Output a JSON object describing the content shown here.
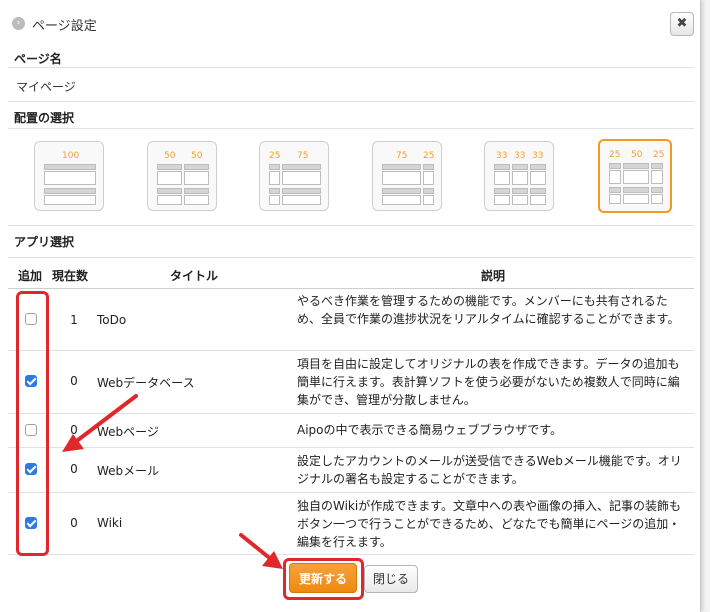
{
  "dialog": {
    "title": "ページ設定",
    "close_label": "✖"
  },
  "page_name": {
    "label": "ページ名",
    "value": "マイページ"
  },
  "layout": {
    "label": "配置の選択",
    "options": [
      {
        "id": "100",
        "nums": [
          "100"
        ]
      },
      {
        "id": "50-50",
        "nums": [
          "50",
          "50"
        ]
      },
      {
        "id": "25-75",
        "nums": [
          "25",
          "75"
        ]
      },
      {
        "id": "75-25",
        "nums": [
          "75",
          "25"
        ]
      },
      {
        "id": "33-33-33",
        "nums": [
          "33",
          "33",
          "33"
        ]
      },
      {
        "id": "25-50-25",
        "nums": [
          "25",
          "50",
          "25"
        ]
      }
    ],
    "selected": "25-50-25"
  },
  "apps": {
    "label": "アプリ選択",
    "headers": {
      "add": "追加",
      "count": "現在数",
      "title": "タイトル",
      "desc": "説明"
    },
    "rows": [
      {
        "checked": false,
        "count": "1",
        "title": "ToDo",
        "desc": "やるべき作業を管理するための機能です。メンバーにも共有されるため、全員で作業の進捗状況をリアルタイムに確認することができます。"
      },
      {
        "checked": true,
        "count": "0",
        "title": "Webデータベース",
        "desc": "項目を自由に設定してオリジナルの表を作成できます。データの追加も簡単に行えます。表計算ソフトを使う必要がないため複数人で同時に編集ができ、管理が分散しません。"
      },
      {
        "checked": false,
        "count": "0",
        "title": "Webページ",
        "desc": "Aipoの中で表示できる簡易ウェブブラウザです。"
      },
      {
        "checked": true,
        "count": "0",
        "title": "Webメール",
        "desc": "設定したアカウントのメールが送受信できるWebメール機能です。オリジナルの署名も設定することができます。"
      },
      {
        "checked": true,
        "count": "0",
        "title": "Wiki",
        "desc": "独自のWikiが作成できます。文章中への表や画像の挿入、記事の装飾もボタン一つで行うことができるため、どなたでも簡単にページの追加・編集を行えます。"
      }
    ]
  },
  "buttons": {
    "update": "更新する",
    "close": "閉じる"
  },
  "colors": {
    "accent": "#f29a1e",
    "highlight": "#e0272c",
    "checkbox": "#2c7be5"
  }
}
